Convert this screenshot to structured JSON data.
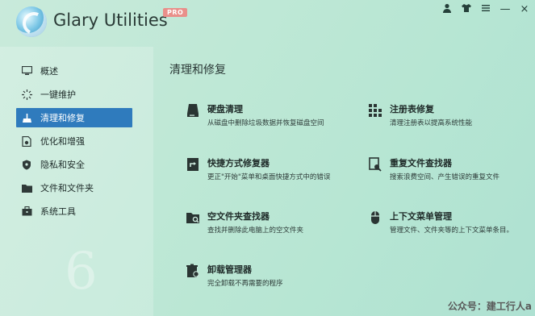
{
  "app": {
    "title": "Glary Utilities",
    "badge": "PRO"
  },
  "window_controls": {
    "user_icon": "user-icon",
    "shirt_icon": "shirt-icon",
    "menu_icon": "menu-icon",
    "minimize": "—",
    "close": "×"
  },
  "sidebar": {
    "items": [
      {
        "label": "概述",
        "icon": "monitor-icon"
      },
      {
        "label": "一键维护",
        "icon": "sparkle-icon"
      },
      {
        "label": "清理和修复",
        "icon": "broom-icon",
        "active": true
      },
      {
        "label": "优化和增强",
        "icon": "document-gear-icon"
      },
      {
        "label": "隐私和安全",
        "icon": "shield-icon"
      },
      {
        "label": "文件和文件夹",
        "icon": "folder-icon"
      },
      {
        "label": "系统工具",
        "icon": "toolbox-icon"
      }
    ]
  },
  "main": {
    "title": "清理和修复",
    "tools": [
      {
        "name": "硬盘清理",
        "desc": "从磁盘中删除垃圾数据并恢复磁盘空间"
      },
      {
        "name": "注册表修复",
        "desc": "清理注册表以提高系统性能"
      },
      {
        "name": "快捷方式修复器",
        "desc": "更正\"开始\"菜单和桌面快捷方式中的错误"
      },
      {
        "name": "重复文件查找器",
        "desc": "搜索浪费空间、产生错误的重复文件"
      },
      {
        "name": "空文件夹查找器",
        "desc": "查找并删除此电脑上的空文件夹"
      },
      {
        "name": "上下文菜单管理",
        "desc": "管理文件、文件夹等的上下文菜单条目。"
      },
      {
        "name": "卸载管理器",
        "desc": "完全卸载不再需要的程序"
      }
    ]
  },
  "watermark": "公众号：建工行人a",
  "colors": {
    "accent": "#2f7bbd",
    "badge": "#e98f8a"
  }
}
